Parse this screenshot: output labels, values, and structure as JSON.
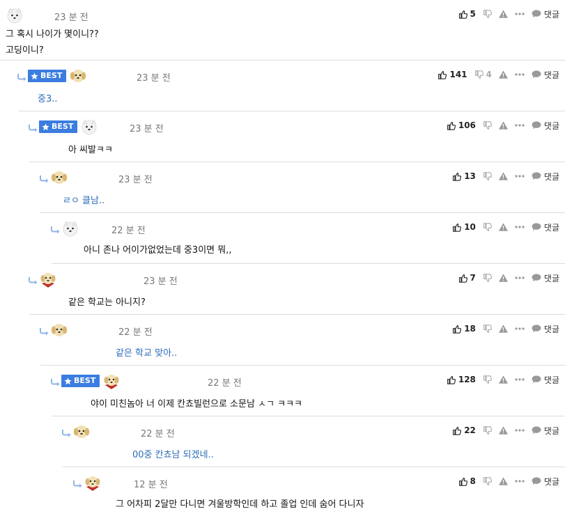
{
  "colors": {
    "accent": "#3b7de0",
    "link_text": "#2b6cb8",
    "divider": "#dcdcdc"
  },
  "labels": {
    "best": "BEST",
    "reply": "댓글"
  },
  "comments": [
    {
      "time": "23 분 전",
      "lines": [
        "그 혹시 나이가 몇이니??",
        "고딩이니?"
      ],
      "likes": "5",
      "dislikes": "",
      "best": false,
      "avatar": "white-dog",
      "blue": false
    },
    {
      "time": "23 분 전",
      "lines": [
        "중3.."
      ],
      "likes": "141",
      "dislikes": "4",
      "best": true,
      "avatar": "yellow-dog",
      "blue": true
    },
    {
      "time": "23 분 전",
      "lines": [
        "아 씨발ㅋㅋ"
      ],
      "likes": "106",
      "dislikes": "",
      "best": true,
      "avatar": "white-dog",
      "blue": false
    },
    {
      "time": "23 분 전",
      "lines": [
        "ㄹㅇ 클남.."
      ],
      "likes": "13",
      "dislikes": "",
      "best": false,
      "avatar": "yellow-dog",
      "blue": true
    },
    {
      "time": "22 분 전",
      "lines": [
        "아니 존나 어이가없었는데 중3이면 뭐,,"
      ],
      "likes": "10",
      "dislikes": "",
      "best": false,
      "avatar": "white-dog",
      "blue": false
    },
    {
      "time": "23 분 전",
      "lines": [
        "같은 학교는 아니지?"
      ],
      "likes": "7",
      "dislikes": "",
      "best": false,
      "avatar": "red-dog",
      "blue": false
    },
    {
      "time": "22 분 전",
      "lines": [
        "같은 학교 맞아.."
      ],
      "likes": "18",
      "dislikes": "",
      "best": false,
      "avatar": "yellow-dog",
      "blue": true
    },
    {
      "time": "22 분 전",
      "lines": [
        "야이 미친놈아 너 이제 칸쵸빌런으로 소문남 ㅅㄱ ㅋㅋㅋ"
      ],
      "likes": "128",
      "dislikes": "",
      "best": true,
      "avatar": "red-dog",
      "blue": false
    },
    {
      "time": "22 분 전",
      "lines": [
        "00중 칸쵸남 되겠네.."
      ],
      "likes": "22",
      "dislikes": "",
      "best": false,
      "avatar": "yellow-dog",
      "blue": true
    },
    {
      "time": "12 분 전",
      "lines": [
        "그 어차피 2달만 다니면 겨울방학인데 하고 졸업 인데 숨어 다니자"
      ],
      "likes": "8",
      "dislikes": "",
      "best": false,
      "avatar": "red-dog",
      "blue": false
    }
  ]
}
